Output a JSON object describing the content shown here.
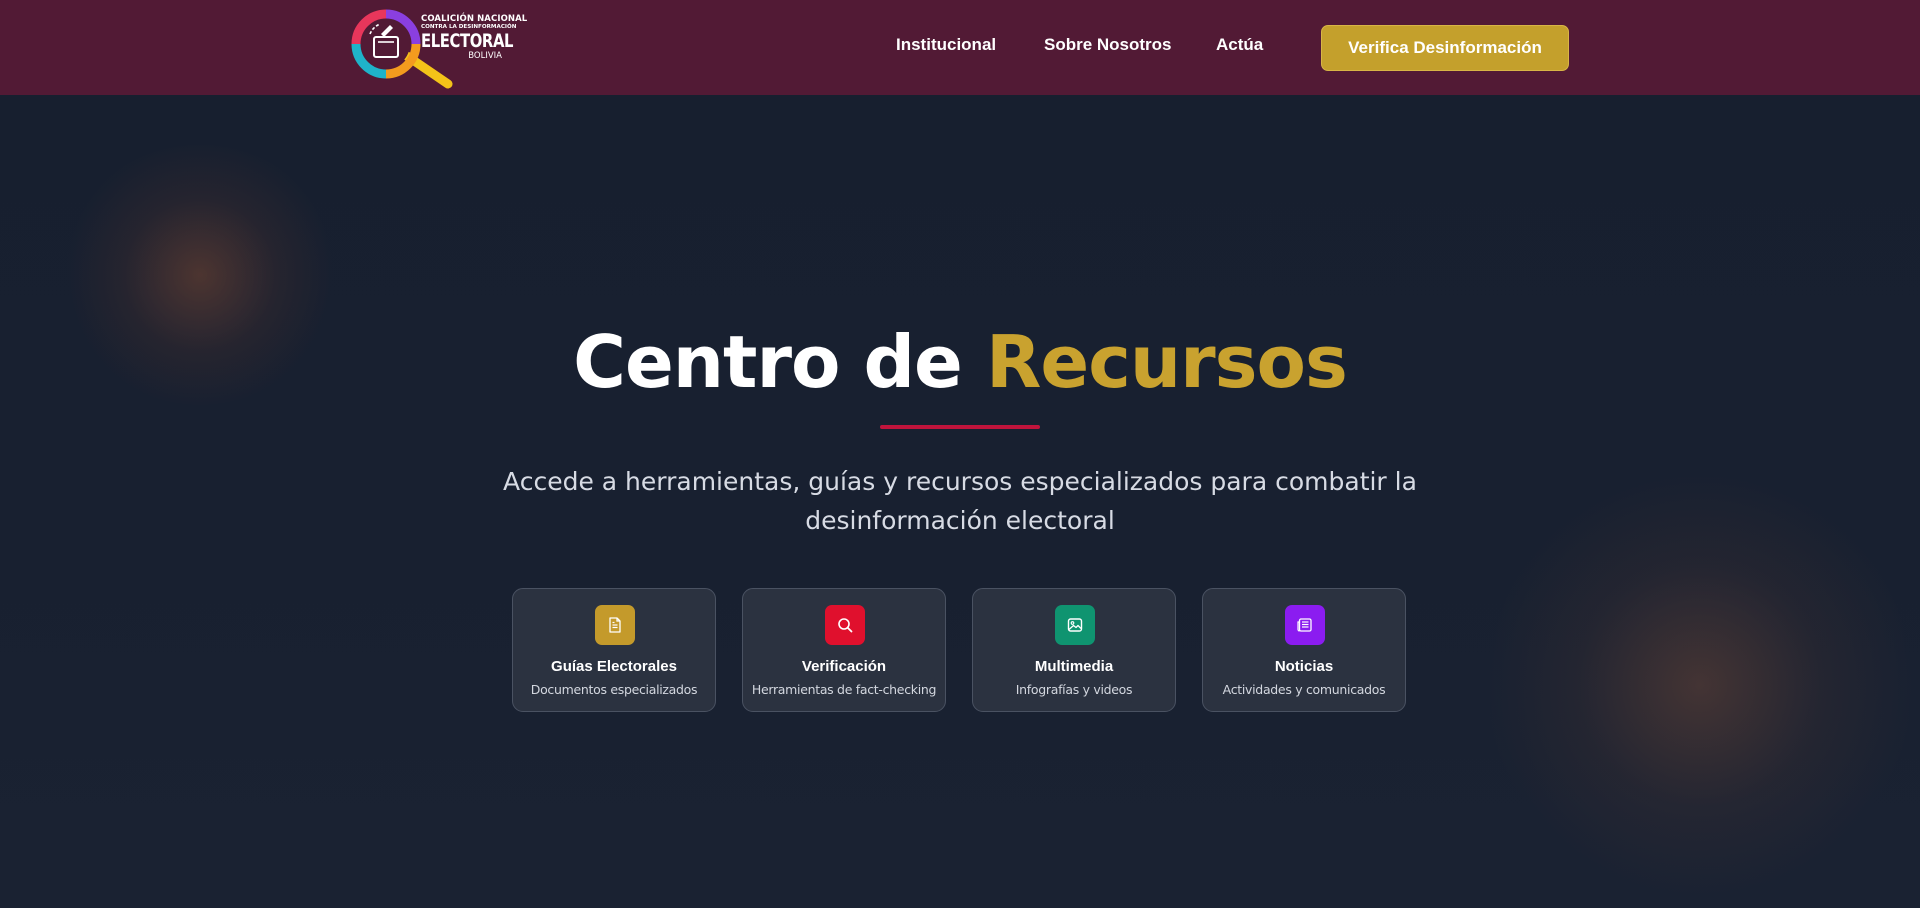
{
  "logo": {
    "line1": "COALICIÓN NACIONAL",
    "line2": "CONTRA LA DESINFORMACIÓN",
    "line3": "ELECTORAL",
    "line4": "BOLIVIA"
  },
  "nav": {
    "links": [
      {
        "label": "Institucional"
      },
      {
        "label": "Sobre Nosotros"
      },
      {
        "label": "Actúa"
      }
    ],
    "cta_label": "Verifica Desinformación"
  },
  "hero": {
    "title_part1": "Centro de ",
    "title_part2": "Recursos",
    "subtitle": "Accede a herramientas, guías y recursos especializados para combatir la desinformación electoral"
  },
  "cards": [
    {
      "title": "Guías Electorales",
      "desc": "Documentos especializados",
      "icon": "document-icon",
      "color": "#c49a2b"
    },
    {
      "title": "Verificación",
      "desc": "Herramientas de fact-checking",
      "icon": "search-icon",
      "color": "#e0102d"
    },
    {
      "title": "Multimedia",
      "desc": "Infografías y videos",
      "icon": "image-icon",
      "color": "#0f9470"
    },
    {
      "title": "Noticias",
      "desc": "Actividades y comunicados",
      "icon": "newspaper-icon",
      "color": "#8b1cf0"
    }
  ],
  "colors": {
    "navbar": "#521a35",
    "accent_gold": "#c9a22f",
    "underline_red": "#c0143c",
    "background": "#171f2f"
  }
}
